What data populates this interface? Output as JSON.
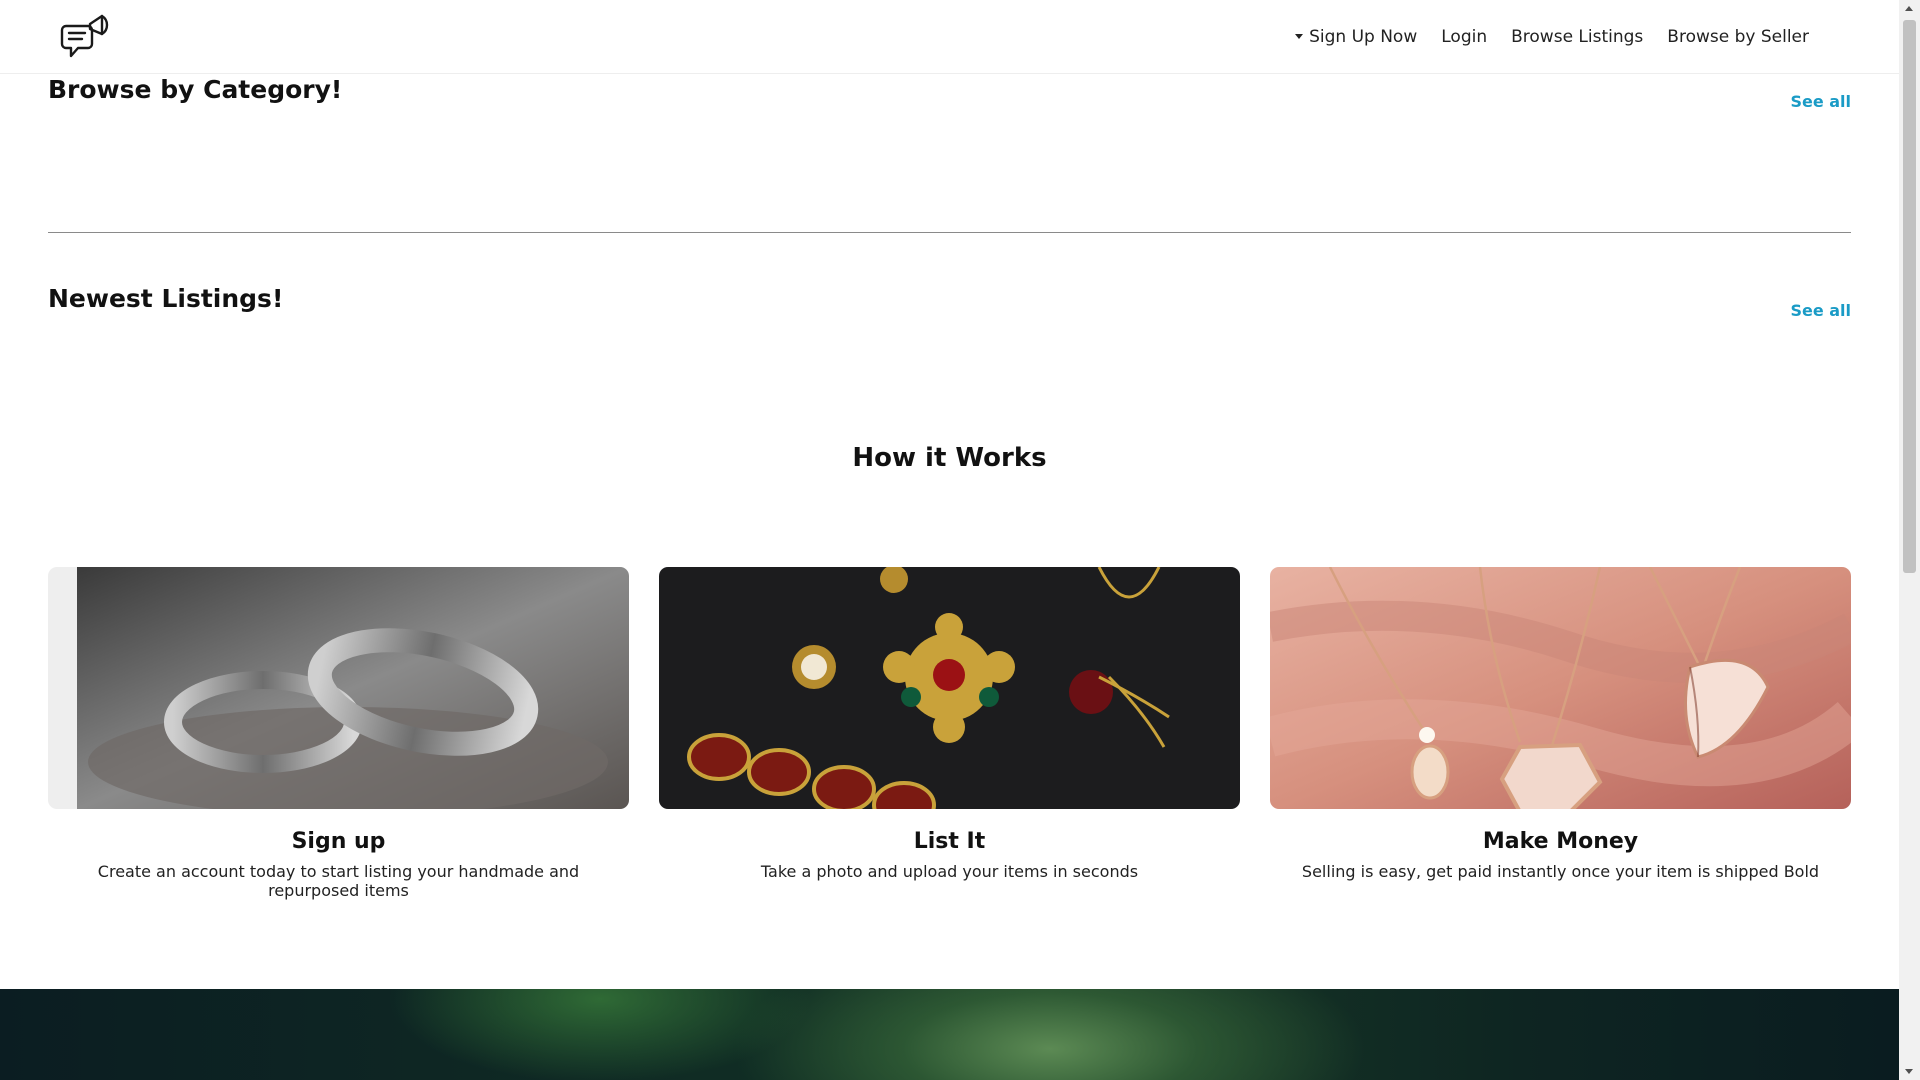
{
  "header": {
    "logo_icon": "megaphone-chat-icon",
    "nav": {
      "signup": "Sign Up Now",
      "login": "Login",
      "browse_listings": "Browse Listings",
      "browse_seller": "Browse by Seller"
    }
  },
  "sections": {
    "category": {
      "title": "Browse by Category!",
      "see_all": "See all"
    },
    "newest": {
      "title": "Newest Listings!",
      "see_all": "See all"
    }
  },
  "how": {
    "title": "How it Works",
    "cards": [
      {
        "title": "Sign up",
        "text": "Create an account today to start listing your handmade and repurposed items",
        "image": "silver-rings-photo"
      },
      {
        "title": "List It",
        "text": "Take a photo and upload your items in seconds",
        "image": "vintage-jewelry-photo"
      },
      {
        "title": "Make Money",
        "text": "Selling is easy, get paid instantly once your item is shipped Bold",
        "image": "rose-gold-necklaces-photo"
      }
    ]
  },
  "colors": {
    "accent": "#1a9bc6",
    "divider": "#8a8a8a"
  }
}
